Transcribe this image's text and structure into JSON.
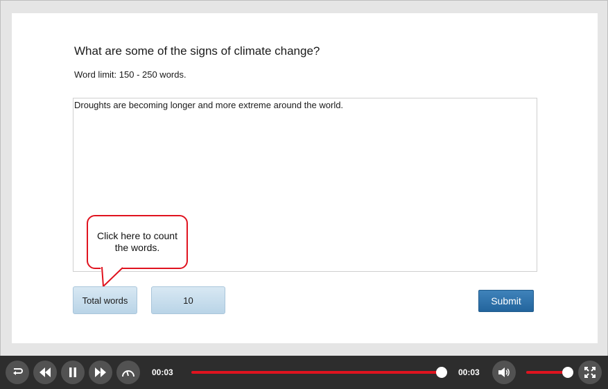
{
  "question": {
    "title": "What are some of the signs of climate change?",
    "word_limit": "Word limit: 150 - 250 words."
  },
  "answer": {
    "text": "Droughts are becoming longer and more extreme around the world."
  },
  "callout": {
    "text": "Click here to count the words."
  },
  "buttons": {
    "total_words": "Total words",
    "word_count": "10",
    "submit": "Submit"
  },
  "player": {
    "current_time": "00:03",
    "total_time": "00:03",
    "progress": 1.0,
    "volume": 1.0,
    "accent_color": "#e0131f",
    "icons": [
      "replay-icon",
      "rewind-icon",
      "pause-icon",
      "forward-icon",
      "speed-icon",
      "volume-icon",
      "fullscreen-icon"
    ]
  }
}
